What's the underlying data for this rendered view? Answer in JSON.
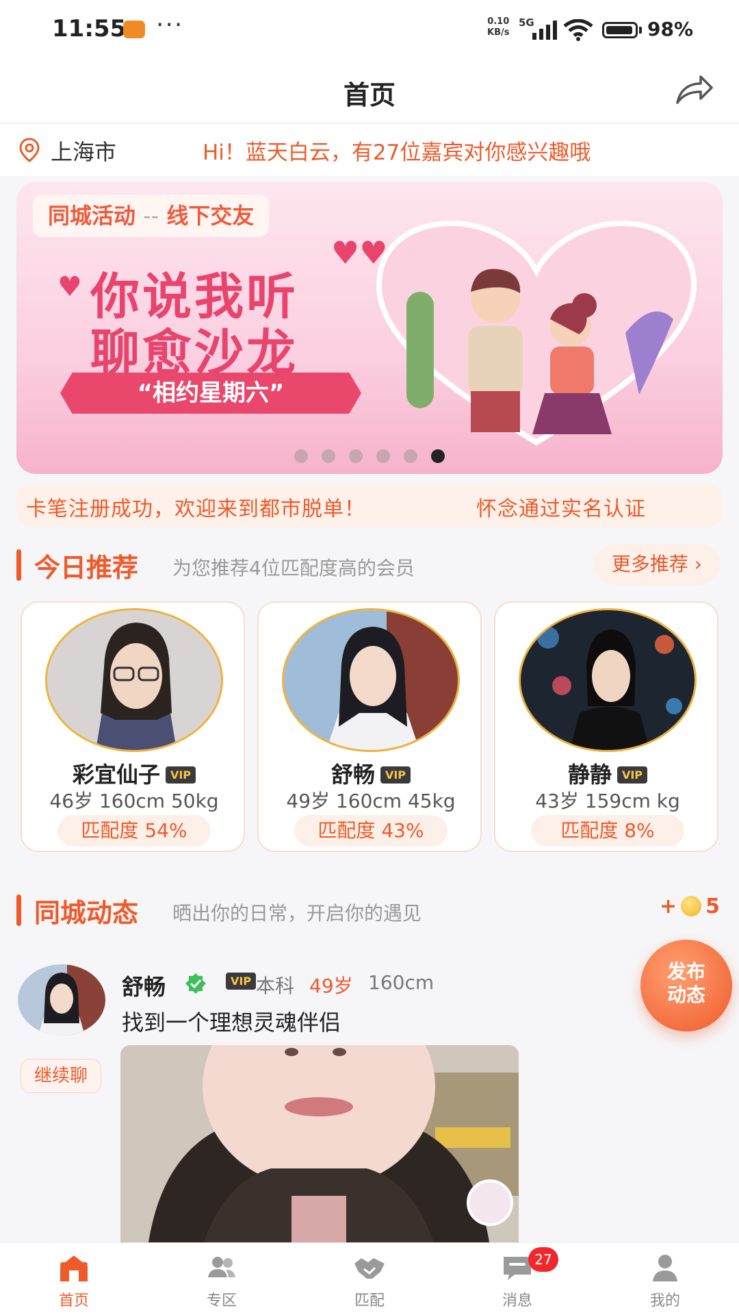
{
  "status_bar": {
    "time": "11:55",
    "net_speed_value": "0.10",
    "net_speed_unit": "KB/s",
    "network": "5G",
    "battery": "98%"
  },
  "header": {
    "title": "首页",
    "share_icon": "share-icon"
  },
  "location_bar": {
    "city": "上海市",
    "greeting": "Hi！蓝天白云，有27位嘉宾对你感兴趣哦"
  },
  "banner": {
    "tag_left": "同城活动",
    "tag_sep": "--",
    "tag_right": "线下交友",
    "line1": "你说我听",
    "line2": "聊愈沙龙",
    "ribbon": "“相约星期六”",
    "dots_total": 6,
    "dots_active": 6
  },
  "ticker": {
    "text1": "卡笔注册成功，欢迎来到都市脱单！",
    "text2": "怀念通过实名认证"
  },
  "recommend": {
    "title": "今日推荐",
    "subtitle": "为您推荐4位匹配度高的会员",
    "more_label": "更多推荐 ›",
    "cards": [
      {
        "name": "彩宜仙子",
        "vip": "VIP",
        "info": "46岁 160cm 50kg",
        "match": "匹配度 54%"
      },
      {
        "name": "舒畅",
        "vip": "VIP",
        "info": "49岁 160cm 45kg",
        "match": "匹配度 43%"
      },
      {
        "name": "静静",
        "vip": "VIP",
        "info": "43岁 159cm kg",
        "match": "匹配度 8%"
      }
    ]
  },
  "moments": {
    "title": "同城动态",
    "subtitle": "晒出你的日常，开启你的遇见",
    "coin_prefix": "+",
    "coin_count": "5"
  },
  "post": {
    "name": "舒畅",
    "vip": "VIP",
    "education": "本科",
    "age": "49岁",
    "height": "160cm",
    "text": "找到一个理想灵魂伴侣",
    "chat_label": "继续聊"
  },
  "fab": {
    "line1": "发布",
    "line2": "动态"
  },
  "tabbar": {
    "items": [
      {
        "label": "首页",
        "icon": "home-icon",
        "active": true
      },
      {
        "label": "专区",
        "icon": "group-icon",
        "active": false
      },
      {
        "label": "匹配",
        "icon": "handshake-icon",
        "active": false
      },
      {
        "label": "消息",
        "icon": "message-icon",
        "active": false,
        "badge": "27"
      },
      {
        "label": "我的",
        "icon": "profile-icon",
        "active": false
      }
    ]
  },
  "colors": {
    "accent": "#ef5a2a",
    "badge": "#f0282b",
    "vip_gold": "#f6c545"
  }
}
